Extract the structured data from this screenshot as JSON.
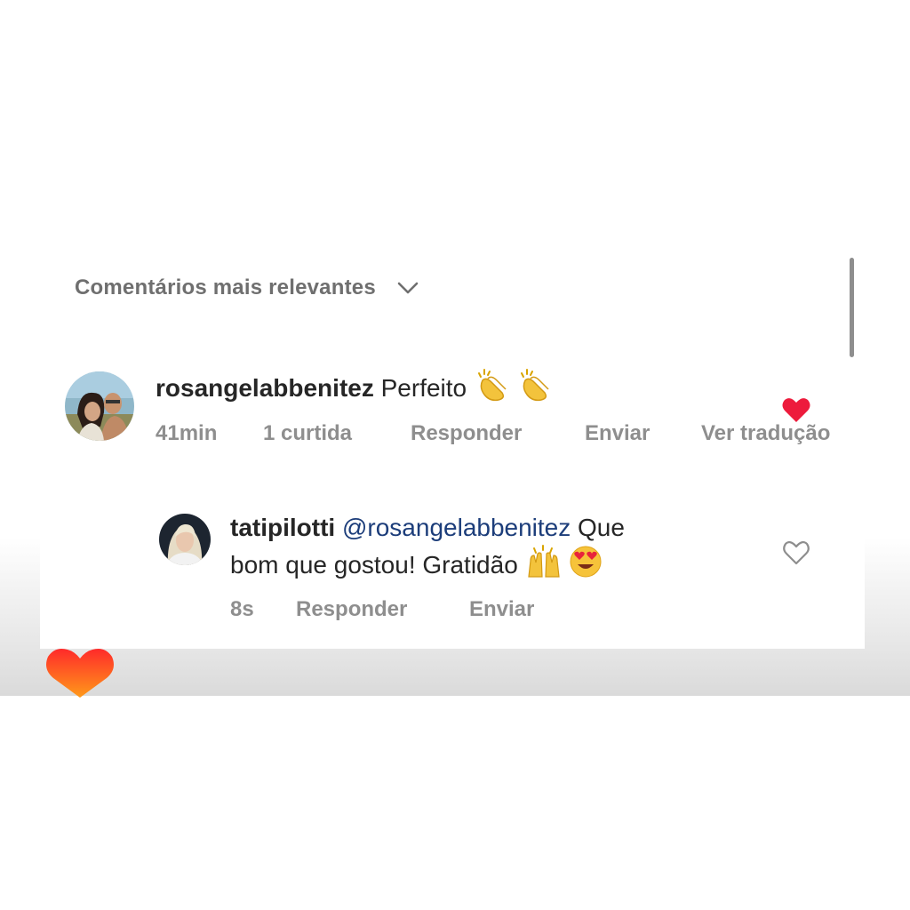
{
  "sort": {
    "label": "Comentários mais relevantes",
    "icon": "chevron-down-icon"
  },
  "comments": [
    {
      "username": "rosangelabbenitez",
      "text": "Perfeito",
      "emojis": [
        "clapping-hands",
        "clapping-hands"
      ],
      "time": "41min",
      "likes": "1 curtida",
      "reply_label": "Responder",
      "send_label": "Enviar",
      "translate_label": "Ver tradução"
    }
  ],
  "replies": [
    {
      "username": "tatipilotti",
      "mention": "@rosangelabbenitez",
      "text_line1_tail": "Que",
      "text_line2": "bom que gostou! Gratidão",
      "emojis": [
        "raising-hands",
        "smiling-face-with-heart-eyes"
      ],
      "time": "8s",
      "reply_label": "Responder",
      "send_label": "Enviar"
    }
  ],
  "colors": {
    "primary_text": "#262626",
    "secondary_text": "#8e8e8e",
    "mention": "#1c3d7a",
    "heart_red": "#ed1b3c",
    "heart_gradient_top": "#ff2a2a",
    "heart_gradient_bottom": "#ff9a1a"
  }
}
